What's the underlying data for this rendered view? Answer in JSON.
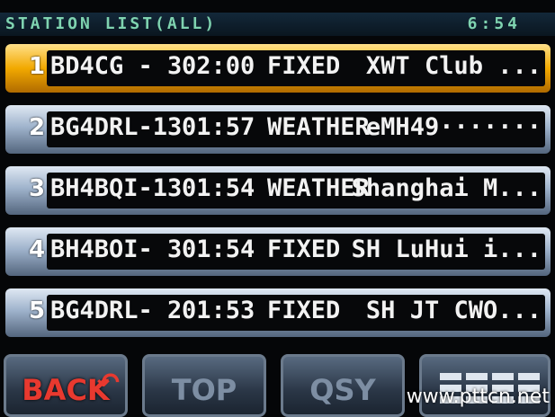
{
  "header": {
    "title": "STATION LIST(ALL)",
    "time": "6:54"
  },
  "stations": [
    {
      "num": "1",
      "call": "BD4CG - 3",
      "time": "02:00",
      "type": "FIXED",
      "comment": "XWT Club ..."
    },
    {
      "num": "2",
      "call": "BG4DRL-13",
      "time": "01:57",
      "type": "WEATHER",
      "comment": "eMH49·······"
    },
    {
      "num": "3",
      "call": "BH4BQI-13",
      "time": "01:54",
      "type": "WEATHER",
      "comment": "Shanghai M..."
    },
    {
      "num": "4",
      "call": "BH4BOI- 3",
      "time": "01:54",
      "type": "FIXED",
      "comment": "SH LuHui i..."
    },
    {
      "num": "5",
      "call": "BG4DRL- 2",
      "time": "01:53",
      "type": "FIXED",
      "comment": "SH JT CWO..."
    }
  ],
  "buttons": {
    "back": "BACK",
    "top": "TOP",
    "qsy": "QSY",
    "menu_icon": "grid-menu-icon"
  },
  "watermark": "www.pttcn.net",
  "colors": {
    "selected_row": "#f2a900",
    "back_label": "#e8392f"
  }
}
